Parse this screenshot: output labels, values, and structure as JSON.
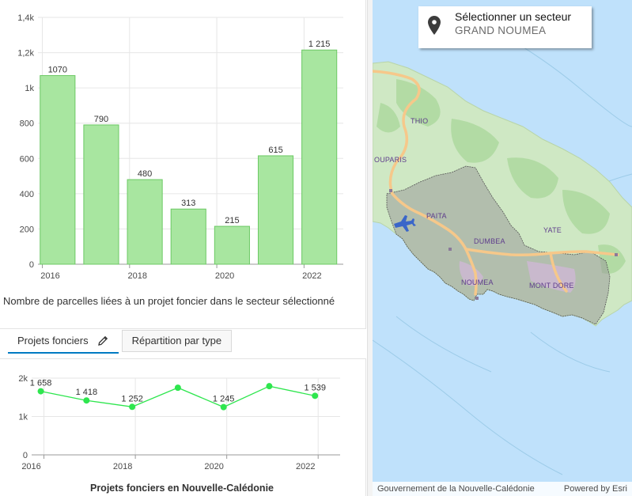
{
  "colors": {
    "bar_fill": "#a8e6a0",
    "bar_stroke": "#6cc964",
    "line_color": "#2ee64e",
    "tab_active": "#007ac2",
    "sea": "#bfe1fb",
    "land": "#cfe8c4",
    "sector": "#9a9a9a"
  },
  "bar_chart": {
    "caption": "Nombre de parcelles liées à un projet foncier dans le secteur sélectionné"
  },
  "tabs": [
    {
      "label": "Projets fonciers",
      "icon": "pencil-icon",
      "active": true
    },
    {
      "label": "Répartition par type",
      "active": false
    }
  ],
  "line_chart": {
    "title": "Projets fonciers en Nouvelle-Calédonie"
  },
  "chart_data": [
    {
      "type": "bar",
      "title": "",
      "xlabel": "",
      "ylabel": "",
      "x": [
        2016,
        2017,
        2018,
        2019,
        2020,
        2021,
        2022
      ],
      "values": [
        1070,
        790,
        480,
        313,
        215,
        615,
        1215
      ],
      "data_labels": [
        "1070",
        "790",
        "480",
        "313",
        "215",
        "615",
        "1 215"
      ],
      "x_ticks": [
        "2016",
        "2018",
        "2020",
        "2022"
      ],
      "y_ticks": [
        "0",
        "200",
        "400",
        "600",
        "800",
        "1k",
        "1,2k",
        "1,4k"
      ],
      "ylim": [
        0,
        1400
      ],
      "grid": true
    },
    {
      "type": "line",
      "title": "Projets fonciers en Nouvelle-Calédonie",
      "xlabel": "",
      "ylabel": "",
      "x": [
        2016,
        2017,
        2018,
        2019,
        2020,
        2021,
        2022
      ],
      "values": [
        1658,
        1418,
        1252,
        1750,
        1245,
        1790,
        1539
      ],
      "data_labels": [
        "1 658",
        "1 418",
        "1 252",
        "",
        "1 245",
        "",
        "1 539"
      ],
      "x_ticks": [
        "2016",
        "2018",
        "2020",
        "2022"
      ],
      "y_ticks": [
        "0",
        "1k",
        "2k"
      ],
      "ylim": [
        0,
        2000
      ],
      "grid": true
    }
  ],
  "map": {
    "selector_title": "Sélectionner un secteur",
    "selector_value": "GRAND NOUMEA",
    "selector_icon": "map-pin-icon",
    "places": [
      "THIO",
      "OUPARIS",
      "PAITA",
      "DUMBEA",
      "YATE",
      "NOUMEA",
      "MONT DORE"
    ],
    "attribution": "Gouvernement de la Nouvelle-Calédonie",
    "powered_by": "Powered by Esri"
  }
}
